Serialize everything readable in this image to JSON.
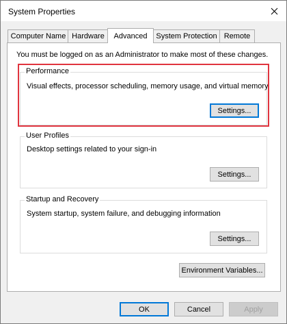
{
  "window": {
    "title": "System Properties",
    "close_glyph": "✕"
  },
  "tabs": [
    {
      "label": "Computer Name",
      "active": false
    },
    {
      "label": "Hardware",
      "active": false
    },
    {
      "label": "Advanced",
      "active": true
    },
    {
      "label": "System Protection",
      "active": false
    },
    {
      "label": "Remote",
      "active": false
    }
  ],
  "advanced": {
    "notice": "You must be logged on as an Administrator to make most of these changes.",
    "performance": {
      "label": "Performance",
      "description": "Visual effects, processor scheduling, memory usage, and virtual memory",
      "button": "Settings..."
    },
    "user_profiles": {
      "label": "User Profiles",
      "description": "Desktop settings related to your sign-in",
      "button": "Settings..."
    },
    "startup_recovery": {
      "label": "Startup and Recovery",
      "description": "System startup, system failure, and debugging information",
      "button": "Settings..."
    },
    "env_button": "Environment Variables..."
  },
  "footer": {
    "ok": "OK",
    "cancel": "Cancel",
    "apply": "Apply"
  },
  "colors": {
    "highlight": "#e0343e",
    "accent": "#0078d7"
  }
}
